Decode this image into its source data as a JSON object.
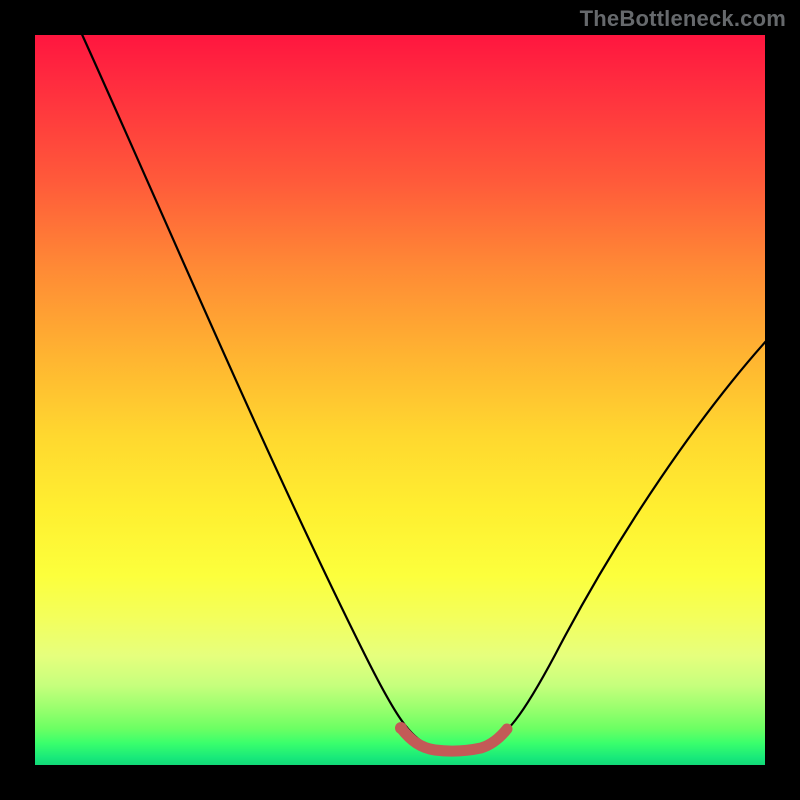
{
  "watermark": "TheBottleneck.com",
  "colors": {
    "frame": "#000000",
    "curve": "#000000",
    "flat_highlight": "#c35a57"
  },
  "chart_data": {
    "type": "line",
    "title": "",
    "xlabel": "",
    "ylabel": "",
    "xlim": [
      0,
      100
    ],
    "ylim": [
      0,
      100
    ],
    "grid": false,
    "legend": false,
    "series": [
      {
        "name": "bottleneck-curve",
        "x": [
          0,
          5,
          10,
          15,
          20,
          25,
          30,
          35,
          40,
          45,
          50,
          52,
          55,
          58,
          60,
          63,
          68,
          75,
          82,
          90,
          100
        ],
        "values": [
          100,
          91,
          82,
          73,
          64,
          55,
          46,
          37,
          28,
          19,
          10,
          4,
          1,
          1,
          1,
          3,
          9,
          18,
          28,
          40,
          55
        ]
      },
      {
        "name": "flat-region-highlight",
        "x": [
          50,
          52,
          54,
          56,
          58,
          60,
          62
        ],
        "values": [
          4,
          1.8,
          1.2,
          1.0,
          1.1,
          1.6,
          3.2
        ]
      }
    ],
    "note": "Curve shape visually estimated; no axis ticks in image."
  }
}
